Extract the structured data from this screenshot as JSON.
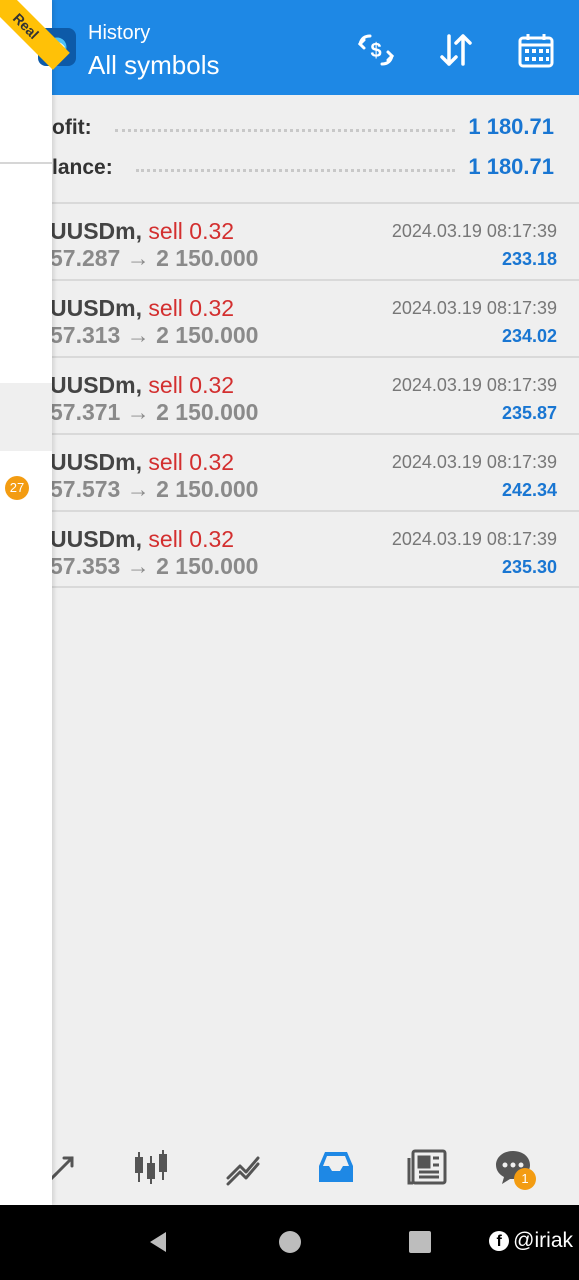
{
  "header": {
    "title": "History",
    "subtitle": "All symbols",
    "icons": [
      "dollar-exchange-icon",
      "sort-icon",
      "calendar-icon"
    ]
  },
  "account_badge": "Real",
  "summary": {
    "profit_label": "ofit:",
    "profit_value": "1 180.71",
    "balance_label": "lance:",
    "balance_value": "1 180.71"
  },
  "trades": [
    {
      "symbol": "UUSDm,",
      "side": "sell 0.32",
      "prices": "57.287 → 2 150.000",
      "time": "2024.03.19 08:17:39",
      "profit": "233.18"
    },
    {
      "symbol": "UUSDm,",
      "side": "sell 0.32",
      "prices": "57.313 → 2 150.000",
      "time": "2024.03.19 08:17:39",
      "profit": "234.02"
    },
    {
      "symbol": "UUSDm,",
      "side": "sell 0.32",
      "prices": "57.371 → 2 150.000",
      "time": "2024.03.19 08:17:39",
      "profit": "235.87"
    },
    {
      "symbol": "UUSDm,",
      "side": "sell 0.32",
      "prices": "57.573 → 2 150.000",
      "time": "2024.03.19 08:17:39",
      "profit": "242.34"
    },
    {
      "symbol": "UUSDm,",
      "side": "sell 0.32",
      "prices": "57.353 → 2 150.000",
      "time": "2024.03.19 08:17:39",
      "profit": "235.30"
    }
  ],
  "drawer": {
    "badge_count": "27"
  },
  "bottom_nav": {
    "items": [
      "quotes-icon",
      "chart-icon",
      "trade-icon",
      "history-icon",
      "news-icon",
      "chat-icon"
    ],
    "active": "history-icon",
    "chat_badge": "1"
  },
  "watermark": "@iriak",
  "colors": {
    "header_bg": "#1e88e5",
    "accent_blue": "#1976d2",
    "sell_red": "#d32f2f",
    "badge_orange": "#f39c12"
  }
}
